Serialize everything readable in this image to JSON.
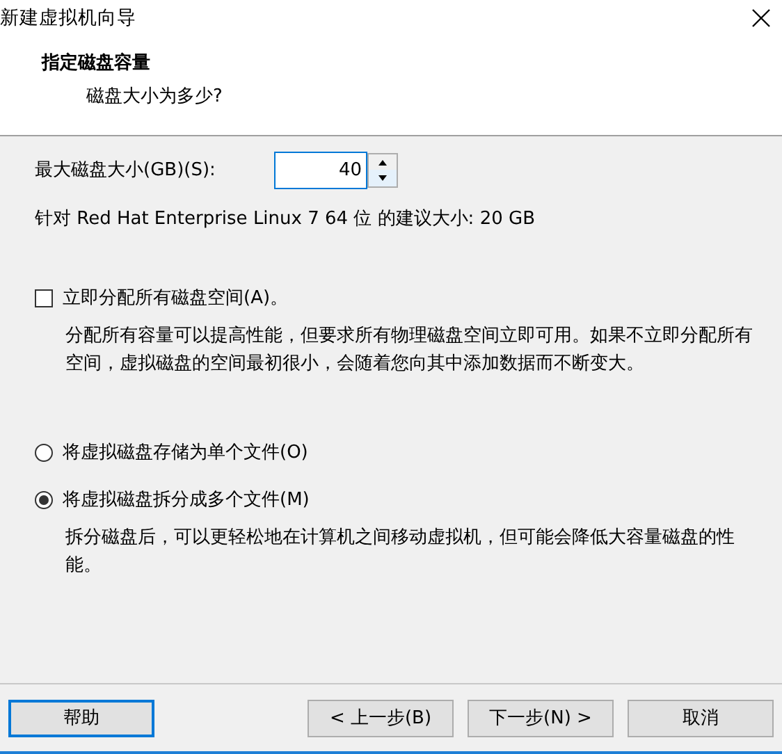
{
  "window": {
    "title": "新建虚拟机向导"
  },
  "header": {
    "title": "指定磁盘容量",
    "subtitle": "磁盘大小为多少?"
  },
  "disk_size": {
    "label": "最大磁盘大小(GB)(S):",
    "value": "40"
  },
  "recommendation": "针对 Red Hat Enterprise Linux 7 64 位 的建议大小: 20 GB",
  "allocate": {
    "label": "立即分配所有磁盘空间(A)。",
    "checked": false,
    "description": "分配所有容量可以提高性能，但要求所有物理磁盘空间立即可用。如果不立即分配所有空间，虚拟磁盘的空间最初很小，会随着您向其中添加数据而不断变大。"
  },
  "storage": [
    {
      "label": "将虚拟磁盘存储为单个文件(O)",
      "selected": false
    },
    {
      "label": "将虚拟磁盘拆分成多个文件(M)",
      "selected": true,
      "description": "拆分磁盘后，可以更轻松地在计算机之间移动虚拟机，但可能会降低大容量磁盘的性能。"
    }
  ],
  "buttons": [
    {
      "label": "帮助",
      "focused": true
    },
    {
      "label": "< 上一步(B)",
      "focused": false
    },
    {
      "label": "下一步(N) >",
      "focused": false
    },
    {
      "label": "取消",
      "focused": false
    }
  ]
}
